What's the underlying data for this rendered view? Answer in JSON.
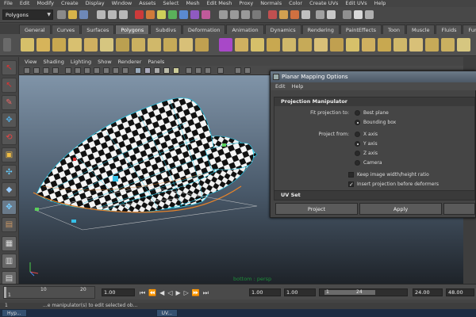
{
  "menubar": [
    "File",
    "Edit",
    "Modify",
    "Create",
    "Display",
    "Window",
    "Assets",
    "Select",
    "Mesh",
    "Edit Mesh",
    "Proxy",
    "Normals",
    "Color",
    "Create UVs",
    "Edit UVs",
    "Help"
  ],
  "status_line": {
    "mode": "Polygons"
  },
  "shelf_tabs": [
    {
      "label": "General",
      "active": false
    },
    {
      "label": "Curves",
      "active": false
    },
    {
      "label": "Surfaces",
      "active": false
    },
    {
      "label": "Polygons",
      "active": true
    },
    {
      "label": "Subdivs",
      "active": false
    },
    {
      "label": "Deformation",
      "active": false
    },
    {
      "label": "Animation",
      "active": false
    },
    {
      "label": "Dynamics",
      "active": false
    },
    {
      "label": "Rendering",
      "active": false
    },
    {
      "label": "PaintEffects",
      "active": false
    },
    {
      "label": "Toon",
      "active": false
    },
    {
      "label": "Muscle",
      "active": false
    },
    {
      "label": "Fluids",
      "active": false
    },
    {
      "label": "Fur",
      "active": false
    }
  ],
  "panel_menu": [
    "View",
    "Shading",
    "Lighting",
    "Show",
    "Renderer",
    "Panels"
  ],
  "viewport": {
    "panel_name": "bottom : persp"
  },
  "dialog": {
    "title": "Planar Mapping Options",
    "menu": [
      "Edit",
      "Help"
    ],
    "projection_manipulator": {
      "header": "Projection Manipulator",
      "fit_label": "Fit projection to:",
      "fit_options": [
        {
          "label": "Best plane",
          "selected": false
        },
        {
          "label": "Bounding box",
          "selected": true
        }
      ],
      "from_label": "Project from:",
      "from_options": [
        {
          "label": "X axis",
          "selected": false
        },
        {
          "label": "Y axis",
          "selected": true
        },
        {
          "label": "Z axis",
          "selected": false
        },
        {
          "label": "Camera",
          "selected": false
        }
      ],
      "checkboxes": [
        {
          "label": "Keep image width/height ratio",
          "checked": false
        },
        {
          "label": "Insert projection before deformers",
          "checked": true
        }
      ]
    },
    "uv_set": {
      "header": "UV Set"
    },
    "buttons": {
      "project": "Project",
      "apply": "Apply"
    }
  },
  "time_slider": {
    "ticks": [
      "1",
      "10",
      "20"
    ],
    "current_frame": "1.00"
  },
  "range_slider": {
    "start": "1.00",
    "playback_start": "1.00",
    "range_start": "1",
    "range_end": "24",
    "end": "24.00",
    "anim_end": "48.00",
    "mini": "1"
  },
  "help_line": "...e manipulator(s) to edit selected ob...",
  "taskbar": [
    "Hyp...",
    "UV..."
  ],
  "colors": {
    "viewport_top": "#8094a8",
    "viewport_bottom": "#1e2329",
    "wire": "#1fc8e8",
    "dialog_title": "#5a6878"
  }
}
